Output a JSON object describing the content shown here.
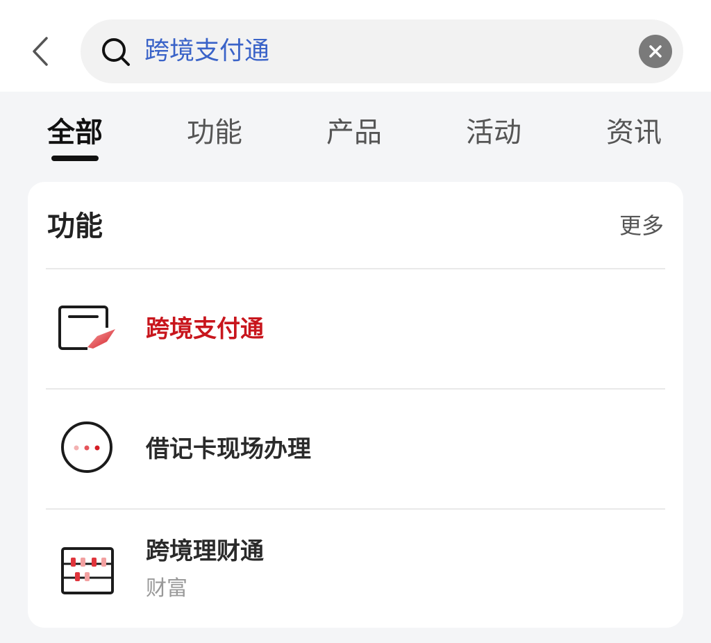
{
  "search": {
    "query": "跨境支付通"
  },
  "tabs": [
    {
      "label": "全部"
    },
    {
      "label": "功能"
    },
    {
      "label": "产品"
    },
    {
      "label": "活动"
    },
    {
      "label": "资讯"
    }
  ],
  "section": {
    "title": "功能",
    "more_label": "更多"
  },
  "results": [
    {
      "title": "跨境支付通",
      "subtitle": "",
      "icon": "payment-card-icon"
    },
    {
      "title": "借记卡现场办理",
      "subtitle": "",
      "icon": "more-dots-icon"
    },
    {
      "title": "跨境理财通",
      "subtitle": "财富",
      "icon": "abacus-icon"
    }
  ],
  "colors": {
    "accent_red": "#c8161d",
    "query_blue": "#3a63c8"
  }
}
